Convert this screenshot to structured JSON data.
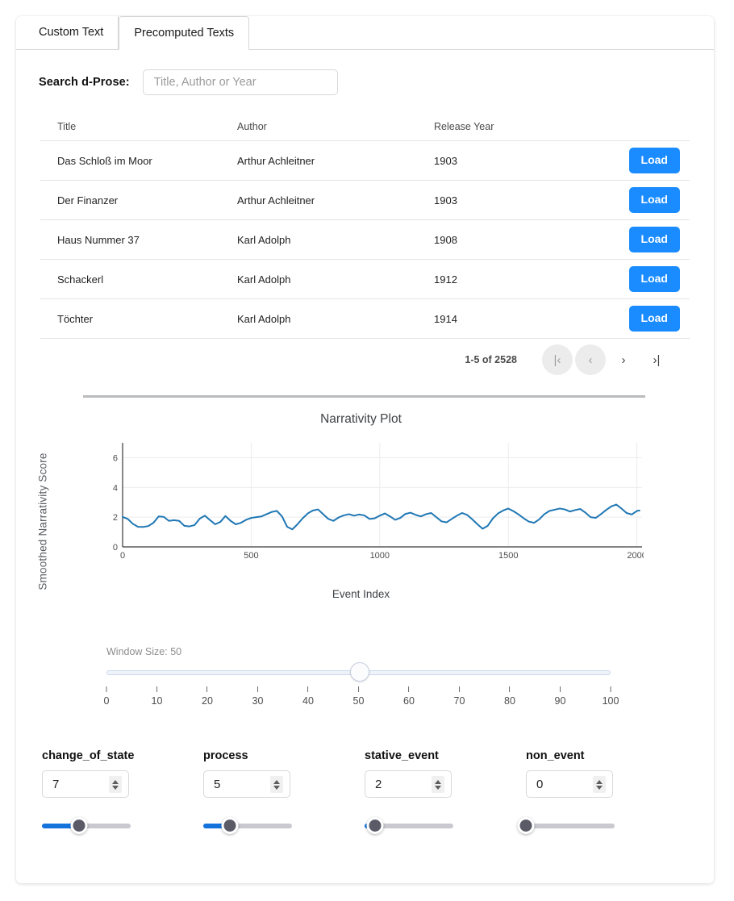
{
  "tabs": [
    {
      "label": "Custom Text",
      "active": false
    },
    {
      "label": "Precomputed Texts",
      "active": true
    }
  ],
  "search": {
    "label": "Search d-Prose:",
    "placeholder": "Title, Author or Year",
    "value": ""
  },
  "table": {
    "columns": [
      "Title",
      "Author",
      "Release Year"
    ],
    "rows": [
      {
        "title": "Das Schloß im Moor",
        "author": "Arthur Achleitner",
        "year": "1903",
        "action": "Load"
      },
      {
        "title": "Der Finanzer",
        "author": "Arthur Achleitner",
        "year": "1903",
        "action": "Load"
      },
      {
        "title": "Haus Nummer 37",
        "author": "Karl Adolph",
        "year": "1908",
        "action": "Load"
      },
      {
        "title": "Schackerl",
        "author": "Karl Adolph",
        "year": "1912",
        "action": "Load"
      },
      {
        "title": "Töchter",
        "author": "Karl Adolph",
        "year": "1914",
        "action": "Load"
      }
    ]
  },
  "pagination": {
    "range_label": "1-5 of 2528",
    "first_icon": "|‹",
    "prev_icon": "‹",
    "next_icon": "›",
    "last_icon": "›|",
    "first_disabled": true,
    "prev_disabled": true
  },
  "chart_data": {
    "type": "line",
    "title": "Narrativity Plot",
    "xlabel": "Event Index",
    "ylabel": "Smoothed Narrativity Score",
    "xlim": [
      0,
      2020
    ],
    "ylim": [
      0,
      7
    ],
    "xticks": [
      0,
      500,
      1000,
      1500,
      2000
    ],
    "yticks": [
      0,
      2,
      4,
      6
    ],
    "grid": true,
    "legend": "none",
    "line_color": "#1f77b4",
    "series": [
      {
        "name": "Smoothed Narrativity Score",
        "x": [
          0,
          20,
          40,
          60,
          80,
          100,
          120,
          140,
          160,
          180,
          200,
          220,
          240,
          260,
          280,
          300,
          320,
          340,
          360,
          380,
          400,
          420,
          440,
          460,
          480,
          500,
          520,
          540,
          560,
          580,
          600,
          620,
          640,
          660,
          680,
          700,
          720,
          740,
          760,
          780,
          800,
          820,
          840,
          860,
          880,
          900,
          920,
          940,
          960,
          980,
          1000,
          1020,
          1040,
          1060,
          1080,
          1100,
          1120,
          1140,
          1160,
          1180,
          1200,
          1220,
          1240,
          1260,
          1280,
          1300,
          1320,
          1340,
          1360,
          1380,
          1400,
          1420,
          1440,
          1460,
          1480,
          1500,
          1520,
          1540,
          1560,
          1580,
          1600,
          1620,
          1640,
          1660,
          1680,
          1700,
          1720,
          1740,
          1760,
          1780,
          1800,
          1820,
          1840,
          1860,
          1880,
          1900,
          1920,
          1940,
          1960,
          1980,
          2000,
          2010
        ],
        "y": [
          2.02,
          1.88,
          1.55,
          1.35,
          1.34,
          1.4,
          1.62,
          2.05,
          2.02,
          1.75,
          1.8,
          1.75,
          1.42,
          1.38,
          1.47,
          1.9,
          2.1,
          1.8,
          1.52,
          1.68,
          2.08,
          1.75,
          1.52,
          1.62,
          1.82,
          1.95,
          2.0,
          2.05,
          2.2,
          2.35,
          2.42,
          2.05,
          1.35,
          1.18,
          1.52,
          1.92,
          2.25,
          2.45,
          2.52,
          2.2,
          1.88,
          1.75,
          1.98,
          2.12,
          2.2,
          2.1,
          2.18,
          2.12,
          1.88,
          1.92,
          2.1,
          2.25,
          2.05,
          1.82,
          1.95,
          2.22,
          2.3,
          2.15,
          2.05,
          2.2,
          2.28,
          2.0,
          1.72,
          1.65,
          1.88,
          2.1,
          2.28,
          2.15,
          1.85,
          1.52,
          1.22,
          1.42,
          1.92,
          2.25,
          2.45,
          2.58,
          2.4,
          2.18,
          1.92,
          1.7,
          1.62,
          1.85,
          2.2,
          2.42,
          2.5,
          2.58,
          2.52,
          2.38,
          2.48,
          2.55,
          2.3,
          2.0,
          1.95,
          2.2,
          2.48,
          2.72,
          2.85,
          2.58,
          2.28,
          2.18,
          2.42,
          2.45
        ]
      }
    ]
  },
  "window_slider": {
    "label": "Window Size: 50",
    "value": 50,
    "min": 0,
    "max": 100,
    "ticks": [
      "0",
      "10",
      "20",
      "30",
      "40",
      "50",
      "60",
      "70",
      "80",
      "90",
      "100"
    ]
  },
  "params": [
    {
      "name": "change_of_state",
      "value": "7",
      "slider_percent": 42
    },
    {
      "name": "process",
      "value": "5",
      "slider_percent": 30
    },
    {
      "name": "stative_event",
      "value": "2",
      "slider_percent": 12
    },
    {
      "name": "non_event",
      "value": "0",
      "slider_percent": 0
    }
  ],
  "colors": {
    "accent": "#1a8cff",
    "slider_fill": "#1472dd",
    "chart_line": "#1f77b4"
  }
}
